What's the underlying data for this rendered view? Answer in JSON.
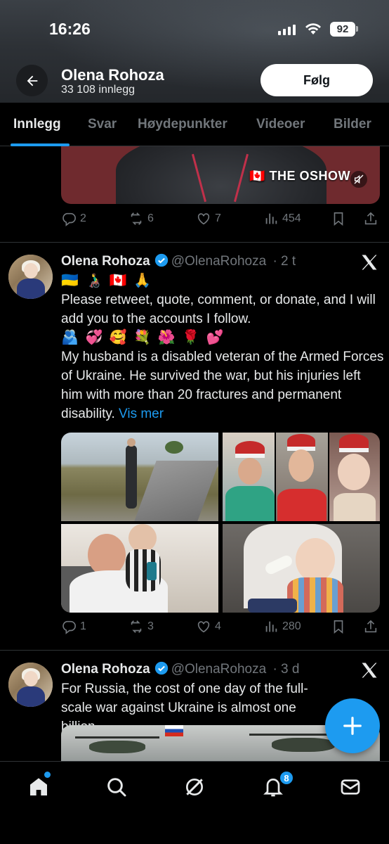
{
  "status_bar": {
    "time": "16:26",
    "battery": "92"
  },
  "header": {
    "profile_name": "Olena Rohoza",
    "post_count": "33 108 innlegg",
    "follow_label": "Følg"
  },
  "tabs": [
    {
      "label": "Innlegg",
      "active": true
    },
    {
      "label": "Svar"
    },
    {
      "label": "Høydepunkter"
    },
    {
      "label": "Videoer"
    },
    {
      "label": "Bilder"
    }
  ],
  "tweet_prev": {
    "video_label": "🇨🇦 THE OSHOW",
    "replies": "2",
    "retweets": "6",
    "likes": "7",
    "views": "454"
  },
  "tweet_main": {
    "author": "Olena Rohoza",
    "handle": "@OlenaRohoza",
    "time": "· 2 t",
    "emoji_line_1": "🇺🇦 👨‍🦽 🇨🇦 🙏",
    "text_1": "Please retweet, quote, comment, or donate, and I will add you to the accounts I follow.",
    "emoji_line_2": "🫂 💞 🥰 💐 🌺 🌹 💕",
    "text_2": "My husband is a disabled veteran of the Armed Forces of Ukraine. He survived the war, but his injuries left him with more than 20 fractures and permanent disability.",
    "more_label": "Vis mer",
    "replies": "1",
    "retweets": "3",
    "likes": "4",
    "views": "280"
  },
  "tweet_next": {
    "author": "Olena Rohoza",
    "handle": "@OlenaRohoza",
    "time": "· 3 d",
    "text": "For Russia, the cost of one day of the full-scale war against Ukraine is almost one billion"
  },
  "bottom_nav": {
    "notifications_badge": "8"
  },
  "colors": {
    "accent": "#1d9bf0",
    "background": "#000000",
    "text": "#e7e9ea",
    "muted": "#71767b"
  },
  "icons": [
    "back-arrow-icon",
    "signal-icon",
    "wifi-icon",
    "battery-icon",
    "reply-icon",
    "retweet-icon",
    "like-icon",
    "views-icon",
    "bookmark-icon",
    "share-icon",
    "verified-icon",
    "x-logo-icon",
    "compose-icon",
    "home-icon",
    "search-icon",
    "grok-icon",
    "notifications-icon",
    "messages-icon",
    "mute-icon"
  ]
}
